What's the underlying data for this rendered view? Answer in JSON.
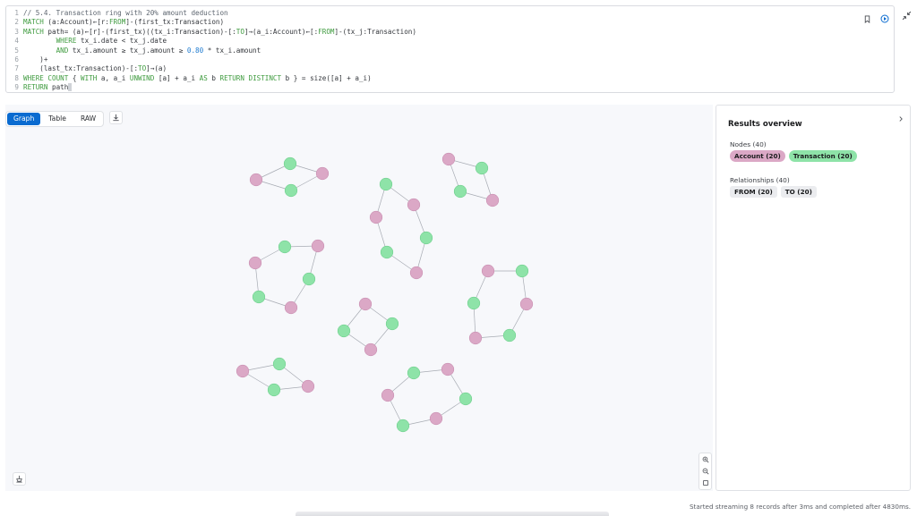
{
  "editor": {
    "lines": [
      {
        "n": "1",
        "tokens": [
          {
            "t": "// 5.4. Transaction ring with 20% amount deduction",
            "c": "c"
          }
        ]
      },
      {
        "n": "2",
        "tokens": [
          {
            "t": "MATCH",
            "c": "k"
          },
          {
            "t": " (a:Account)←[r:",
            "c": "p"
          },
          {
            "t": "FROM",
            "c": "k"
          },
          {
            "t": "]-(first_tx:Transaction)",
            "c": "p"
          }
        ]
      },
      {
        "n": "3",
        "tokens": [
          {
            "t": "MATCH",
            "c": "k"
          },
          {
            "t": " path= (a)←[r]-(first_tx)((tx_i:Transaction)-[:",
            "c": "p"
          },
          {
            "t": "TO",
            "c": "k"
          },
          {
            "t": "]→(a_i:Account)←[:",
            "c": "p"
          },
          {
            "t": "FROM",
            "c": "k"
          },
          {
            "t": "]-(tx_j:Transaction)",
            "c": "p"
          }
        ]
      },
      {
        "n": "4",
        "tokens": [
          {
            "t": "        ",
            "c": "p"
          },
          {
            "t": "WHERE",
            "c": "k"
          },
          {
            "t": " tx_i.date < tx_j.date",
            "c": "p"
          }
        ]
      },
      {
        "n": "5",
        "tokens": [
          {
            "t": "        ",
            "c": "p"
          },
          {
            "t": "AND",
            "c": "k"
          },
          {
            "t": " tx_i.amount ≥ tx_j.amount ≥ ",
            "c": "p"
          },
          {
            "t": "0.80",
            "c": "n"
          },
          {
            "t": " * tx_i.amount",
            "c": "p"
          }
        ]
      },
      {
        "n": "6",
        "tokens": [
          {
            "t": "    )+",
            "c": "p"
          }
        ]
      },
      {
        "n": "7",
        "tokens": [
          {
            "t": "    (last_tx:Transaction)-[:",
            "c": "p"
          },
          {
            "t": "TO",
            "c": "k"
          },
          {
            "t": "]→(a)",
            "c": "p"
          }
        ]
      },
      {
        "n": "8",
        "tokens": [
          {
            "t": "WHERE COUNT",
            "c": "k"
          },
          {
            "t": " { ",
            "c": "p"
          },
          {
            "t": "WITH",
            "c": "k"
          },
          {
            "t": " a, a_i ",
            "c": "p"
          },
          {
            "t": "UNWIND",
            "c": "k"
          },
          {
            "t": " [a] + a_i ",
            "c": "p"
          },
          {
            "t": "AS",
            "c": "k"
          },
          {
            "t": " b ",
            "c": "p"
          },
          {
            "t": "RETURN DISTINCT",
            "c": "k"
          },
          {
            "t": " b } = size([a] + a_i)",
            "c": "p"
          }
        ]
      },
      {
        "n": "9",
        "tokens": [
          {
            "t": "RETURN",
            "c": "k"
          },
          {
            "t": " path",
            "c": "p"
          }
        ]
      }
    ]
  },
  "tabs": {
    "graph": "Graph",
    "table": "Table",
    "raw": "RAW"
  },
  "icons": {
    "bookmark": "bookmark-icon",
    "run": "run-icon",
    "collapse": "collapse-icon",
    "download": "download-icon",
    "zoom_in": "zoom-in-icon",
    "zoom_out": "zoom-out-icon",
    "fit": "fit-view-icon",
    "layout": "layout-icon",
    "chevron": "chevron-right-icon"
  },
  "colors": {
    "account": "#dba8c6",
    "transaction": "#8ee3a8",
    "active_tab": "#0a6bd0"
  },
  "results": {
    "title": "Results overview",
    "nodes_label": "Nodes (40)",
    "node_chips": [
      {
        "label": "Account (20)",
        "kind": "account"
      },
      {
        "label": "Transaction (20)",
        "kind": "transaction"
      }
    ],
    "rels_label": "Relationships (40)",
    "rel_chips": [
      {
        "label": "FROM (20)"
      },
      {
        "label": "TO (20)"
      }
    ]
  },
  "status": "Started streaming 8 records after 3ms and completed after 4830ms."
}
